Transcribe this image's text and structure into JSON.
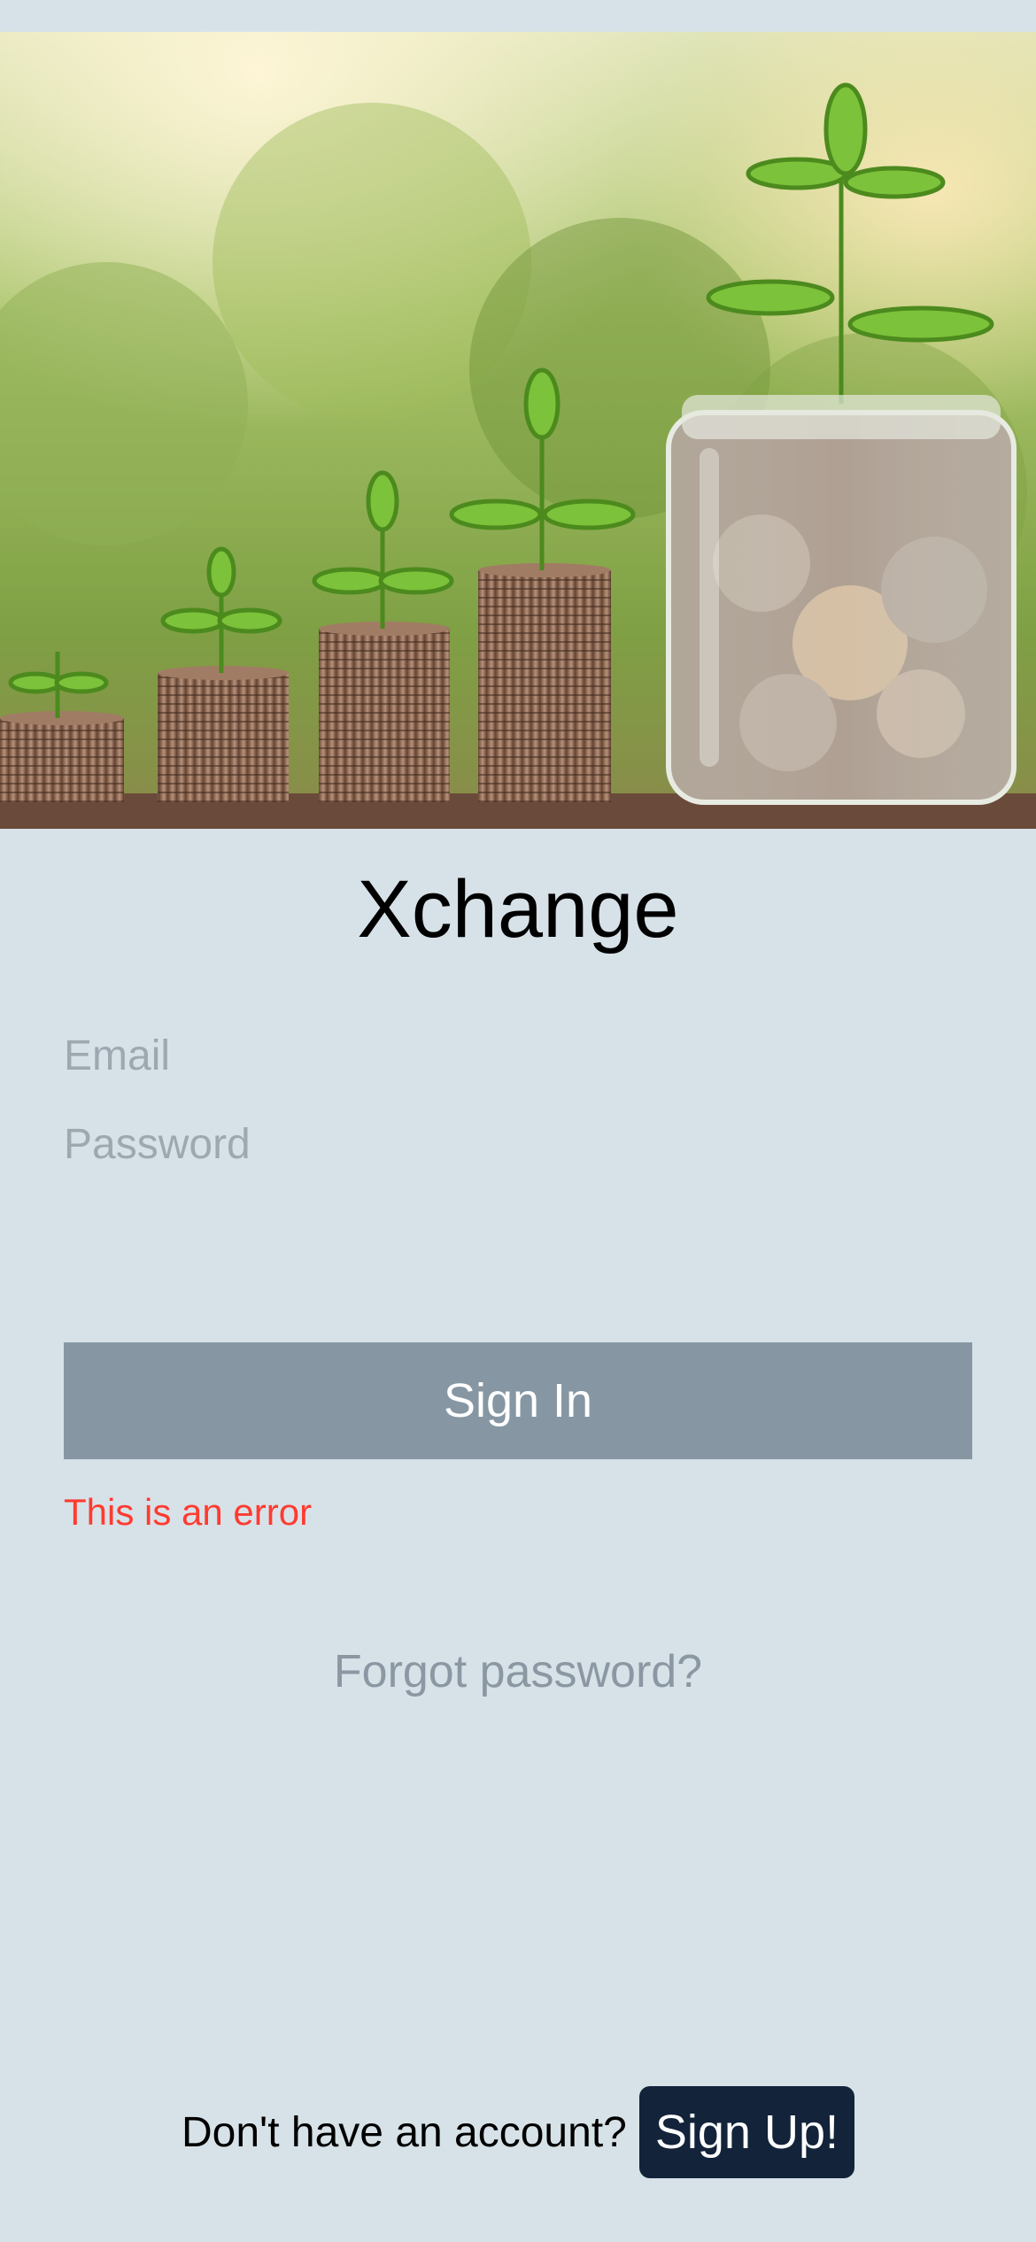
{
  "hero": {
    "image": "coins-and-plants-photo"
  },
  "app": {
    "title": "Xchange"
  },
  "form": {
    "email_placeholder": "Email",
    "password_placeholder": "Password",
    "signin_label": "Sign In",
    "error_message": "This is an error",
    "forgot_label": "Forgot password?"
  },
  "footer": {
    "prompt": "Don't have an account?",
    "signup_label": "Sign Up!"
  },
  "colors": {
    "background": "#d7e2e8",
    "signin_button": "#8697a3",
    "error": "#ff3b30",
    "signup_button": "#12233a"
  }
}
